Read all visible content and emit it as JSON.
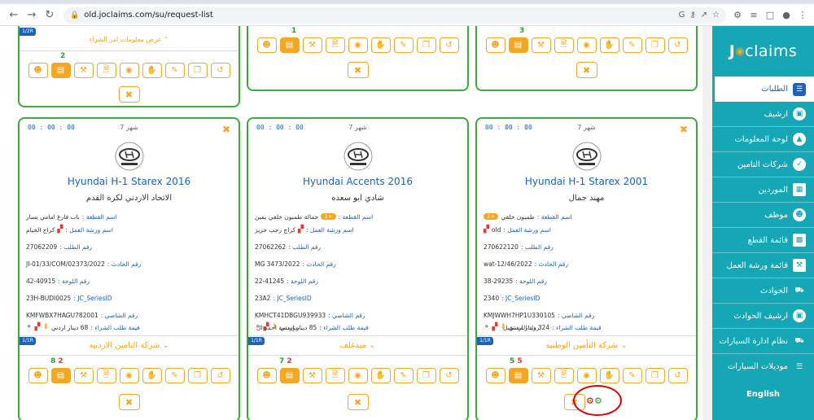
{
  "browser": {
    "url": "old.joclaims.com/su/request-list",
    "omnibox_icons": [
      "G",
      "key-icon",
      "share-icon",
      "star-icon"
    ]
  },
  "top_cards": [
    {
      "note": "عرض معلومات امر الشراء",
      "badge": "1/2R",
      "count_green": "2",
      "count_red": ""
    },
    {
      "note": "",
      "badge": "",
      "count_green": "1",
      "count_red": ""
    },
    {
      "note": "",
      "badge": "",
      "count_green": "3",
      "count_red": ""
    }
  ],
  "cards": [
    {
      "timer": "00 : 00 : 00",
      "months": "7 شهر",
      "title": "Hyundai H-1 Starex  2016",
      "owner": "الاتحاد الاردني لكرة القدم",
      "part_label": "اسم القطعة :",
      "part_value": "باب فارغ امامي يسار",
      "part_pill": "",
      "workshop_label": "اسم ورشة العمل :",
      "workshop_value": "كراج الخيام",
      "request_label": "رقم الطلب :",
      "request_value": "27062209",
      "incident_label": "رقم الحادث :",
      "incident_value": "JI-01/33/COM/02373/2022",
      "plate_label": "رقم اللوحة :",
      "plate_value": "42-40915",
      "series_label": "JC_SeriesID :",
      "series_value": "23H-BUDI0025",
      "chassis_label": "رقم الشاصي :",
      "chassis_value": "KMFWBX7HAGU782001",
      "po_label": "قيمة طلب الشراء :",
      "po_value": "68 دينار اردني",
      "left_note": "",
      "badge": "1/1R",
      "insurer": "شركة التامين الاردنيه",
      "count_green": "8",
      "count_red": "2"
    },
    {
      "timer": "00 : 00 : 00",
      "months": "7 شهر",
      "title": "Hyundai Accents  2016",
      "owner": "شادي ابو سعده",
      "part_label": "اسم القطعة :",
      "part_value": "حمالة طمبون خلفي يمين",
      "part_pill": "+1",
      "workshop_label": "اسم ورشة العمل :",
      "workshop_value": "كراج رجب حريز",
      "request_label": "رقم الطلب :",
      "request_value": "27062262",
      "incident_label": "رقم الحادث :",
      "incident_value": "MG 3473/2022",
      "plate_label": "رقم اللوحة :",
      "plate_value": "22-41245",
      "series_label": "JC_SeriesID :",
      "series_value": "23A2",
      "chassis_label": "رقم الشاصي :",
      "chassis_value": "KMHCT41DBGU939933",
      "po_label": "قيمة طلب الشراء :",
      "po_value": "85 دينار اردني",
      "left_note": "مؤسسة احمد ال",
      "badge": "1/1R",
      "insurer": "ميدغلف",
      "count_green": "7",
      "count_red": "2"
    },
    {
      "timer": "00 : 00 : 00",
      "months": "7 شهر",
      "title": "Hyundai H-1 Starex  2001",
      "owner": "مهند جمال",
      "part_label": "اسم القطعة :",
      "part_value": "طمبون خلفي",
      "part_pill": "+2",
      "workshop_label": "اسم ورشة العمل :",
      "workshop_value": "old",
      "request_label": "رقم الطلب :",
      "request_value": "270622120",
      "incident_label": "رقم الحادث :",
      "incident_value": "wat-12/46/2022",
      "plate_label": "رقم اللوحة :",
      "plate_value": "38-29235",
      "series_label": "JC_SeriesID :",
      "series_value": "2340",
      "chassis_label": "رقم الشاصي :",
      "chassis_value": "KMJWWH7HP1U330105",
      "po_label": "قيمة طلب الشراء :",
      "po_value": "324 دينار اردني",
      "left_note": "رواد المستقبل",
      "badge": "1/1R",
      "insurer": "شركة التأمين الوطنيه",
      "count_green": "5",
      "count_red": "5"
    }
  ],
  "sidebar": {
    "brand_a": "J",
    "brand_b": "claims",
    "items": [
      {
        "label": "الطلبات",
        "icon": "list-icon"
      },
      {
        "label": "ارشيف",
        "icon": "archive-icon"
      },
      {
        "label": "لوحة المعلومات",
        "icon": "dashboard-icon"
      },
      {
        "label": "شركات التامين",
        "icon": "shield-icon"
      },
      {
        "label": "الموردين",
        "icon": "store-icon"
      },
      {
        "label": "موظف",
        "icon": "user-icon"
      },
      {
        "label": "قائمة القطع",
        "icon": "parts-icon"
      },
      {
        "label": "قائمة ورشة العمل",
        "icon": "workshop-icon"
      },
      {
        "label": "الحوادث",
        "icon": "car-crash-icon"
      },
      {
        "label": "ارشيف الحوادث",
        "icon": "archive-icon"
      },
      {
        "label": "نظام ادارة السيارات",
        "icon": "car-icon"
      },
      {
        "label": "موديلات السيارات",
        "icon": "list-icon"
      }
    ],
    "language": "English"
  }
}
